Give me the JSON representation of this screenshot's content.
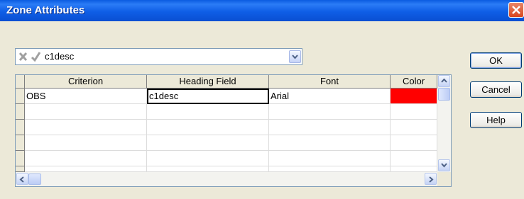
{
  "window": {
    "title": "Zone Attributes"
  },
  "editbar": {
    "value": "c1desc"
  },
  "grid": {
    "columns": [
      "Criterion",
      "Heading Field",
      "Font",
      "Color"
    ],
    "rows": [
      {
        "criterion": "OBS",
        "heading_field": "c1desc",
        "font": "Arial",
        "color": "#ff0000"
      }
    ]
  },
  "buttons": {
    "ok": "OK",
    "cancel": "Cancel",
    "help": "Help"
  },
  "icons": {
    "close": "close-icon",
    "cancel_edit": "x-icon",
    "accept_edit": "check-icon",
    "dropdown": "chevron-down-icon",
    "scroll_up": "arrow-up-icon",
    "scroll_down": "arrow-down-icon",
    "scroll_left": "arrow-left-icon",
    "scroll_right": "arrow-right-icon"
  }
}
